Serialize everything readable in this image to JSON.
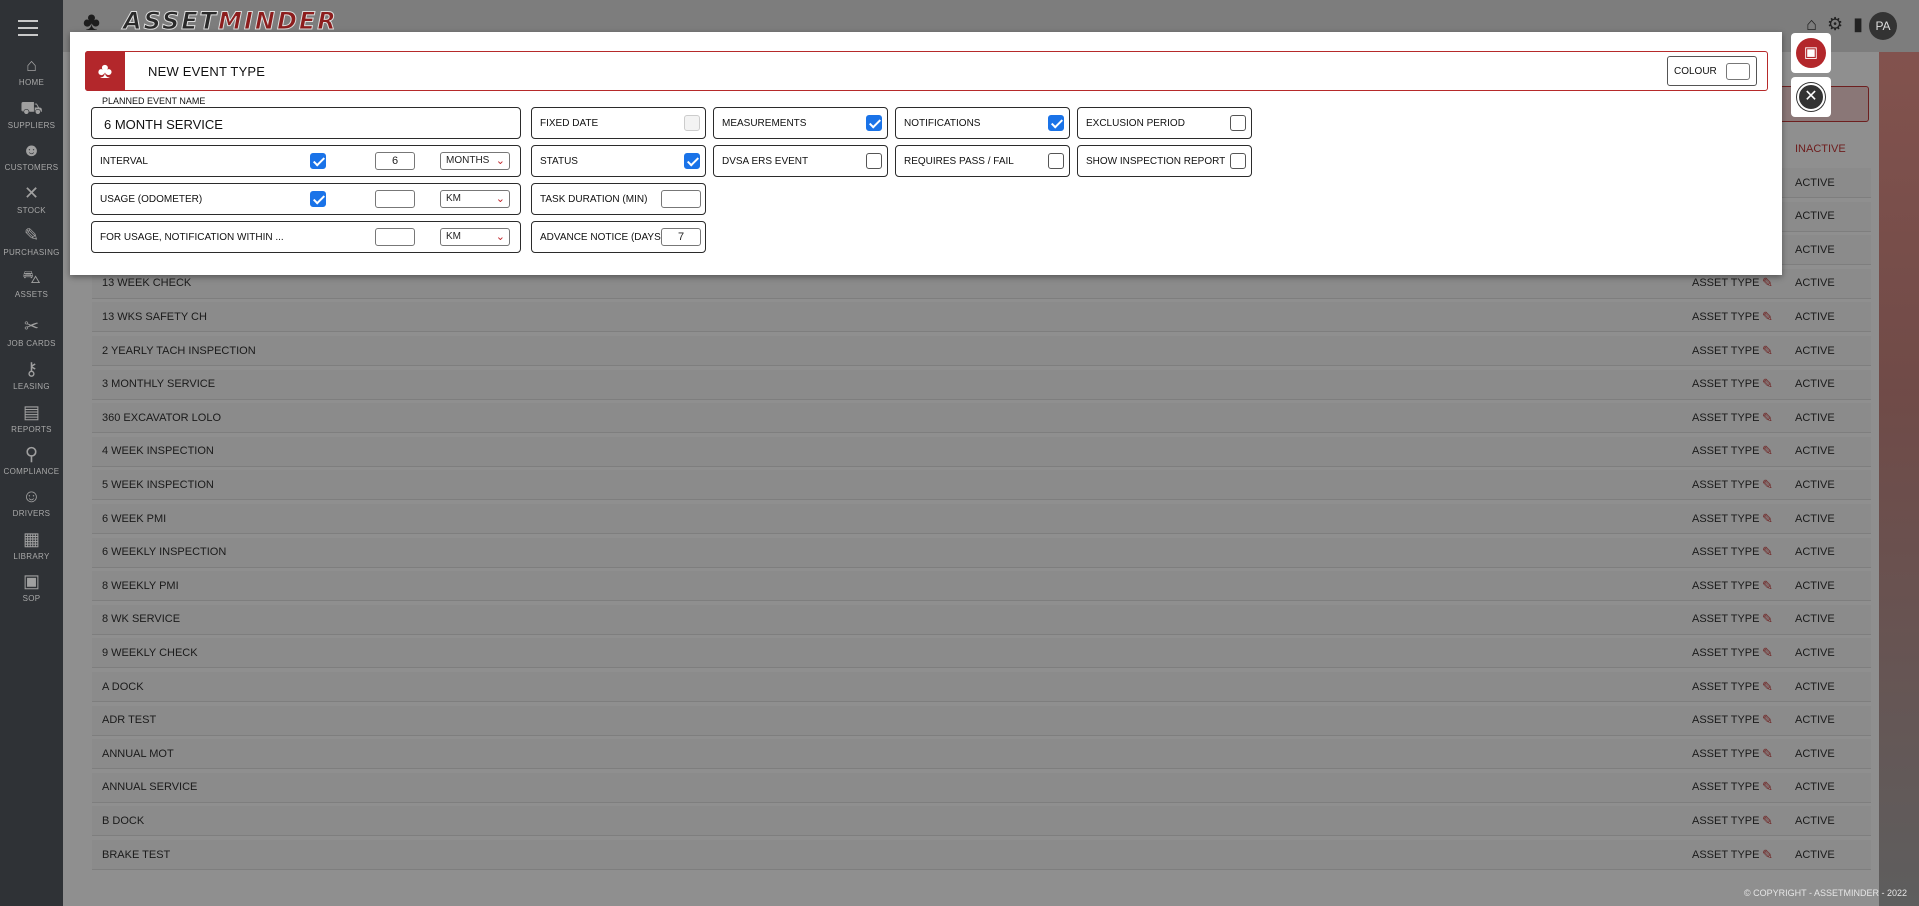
{
  "app": {
    "brand_a": "ASSET",
    "brand_b": "MINDER",
    "user_initials": "PA"
  },
  "sidebar": {
    "items": [
      {
        "label": "HOME",
        "icon": "⌂"
      },
      {
        "label": "SUPPLIERS",
        "icon": "⛟"
      },
      {
        "label": "CUSTOMERS",
        "icon": "☻"
      },
      {
        "label": "STOCK",
        "icon": "✕"
      },
      {
        "label": "PURCHASING",
        "icon": "✎"
      },
      {
        "label": "ASSETS",
        "icon": "⛍"
      },
      {
        "label": "JOB CARDS",
        "icon": "✂"
      },
      {
        "label": "LEASING",
        "icon": "⚷"
      },
      {
        "label": "REPORTS",
        "icon": "▤"
      },
      {
        "label": "COMPLIANCE",
        "icon": "⚲"
      },
      {
        "label": "DRIVERS",
        "icon": "☺"
      },
      {
        "label": "LIBRARY",
        "icon": "▦"
      },
      {
        "label": "SOP",
        "icon": "▣"
      }
    ]
  },
  "table": {
    "header_inactive": "INACTIVE",
    "rows": [
      {
        "name": "",
        "type": "",
        "status": "ACTIVE"
      },
      {
        "name": "",
        "type": "",
        "status": "ACTIVE"
      },
      {
        "name": "",
        "type": "",
        "status": "ACTIVE"
      },
      {
        "name": "13 WEEK CHECK",
        "type": "ASSET TYPE",
        "status": "ACTIVE"
      },
      {
        "name": "13 WKS SAFETY CH",
        "type": "ASSET TYPE",
        "status": "ACTIVE"
      },
      {
        "name": "2 YEARLY TACH INSPECTION",
        "type": "ASSET TYPE",
        "status": "ACTIVE"
      },
      {
        "name": "3 MONTHLY SERVICE",
        "type": "ASSET TYPE",
        "status": "ACTIVE"
      },
      {
        "name": "360 EXCAVATOR LOLO",
        "type": "ASSET TYPE",
        "status": "ACTIVE"
      },
      {
        "name": "4 WEEK INSPECTION",
        "type": "ASSET TYPE",
        "status": "ACTIVE"
      },
      {
        "name": "5 WEEK INSPECTION",
        "type": "ASSET TYPE",
        "status": "ACTIVE"
      },
      {
        "name": "6 WEEK PMI",
        "type": "ASSET TYPE",
        "status": "ACTIVE"
      },
      {
        "name": "6 WEEKLY INSPECTION",
        "type": "ASSET TYPE",
        "status": "ACTIVE"
      },
      {
        "name": "8 WEEKLY PMI",
        "type": "ASSET TYPE",
        "status": "ACTIVE"
      },
      {
        "name": "8 WK SERVICE",
        "type": "ASSET TYPE",
        "status": "ACTIVE"
      },
      {
        "name": "9 WEEKLY CHECK",
        "type": "ASSET TYPE",
        "status": "ACTIVE"
      },
      {
        "name": "A DOCK",
        "type": "ASSET TYPE",
        "status": "ACTIVE"
      },
      {
        "name": "ADR TEST",
        "type": "ASSET TYPE",
        "status": "ACTIVE"
      },
      {
        "name": "ANNUAL MOT",
        "type": "ASSET TYPE",
        "status": "ACTIVE"
      },
      {
        "name": "ANNUAL SERVICE",
        "type": "ASSET TYPE",
        "status": "ACTIVE"
      },
      {
        "name": "B DOCK",
        "type": "ASSET TYPE",
        "status": "ACTIVE"
      },
      {
        "name": "BRAKE TEST",
        "type": "ASSET TYPE",
        "status": "ACTIVE"
      }
    ]
  },
  "footer": {
    "copyright": "© COPYRIGHT - ASSETMINDER - 2022"
  },
  "modal": {
    "title": "NEW EVENT TYPE",
    "colour_label": "COLOUR",
    "planned_event_name_label": "PLANNED EVENT NAME",
    "planned_event_name_value": "6 MONTH SERVICE",
    "interval": {
      "label": "INTERVAL",
      "checked": true,
      "value": "6",
      "unit": "MONTHS"
    },
    "usage": {
      "label": "USAGE (ODOMETER)",
      "checked": true,
      "value": "",
      "unit": "KM"
    },
    "for_usage": {
      "label": "FOR USAGE, NOTIFICATION WITHIN ...",
      "value": "",
      "unit": "KM"
    },
    "fixed_date": {
      "label": "FIXED DATE",
      "checked": false,
      "disabled": true
    },
    "status": {
      "label": "STATUS",
      "checked": true
    },
    "task_duration": {
      "label": "TASK DURATION (MIN)",
      "value": ""
    },
    "advance_notice": {
      "label": "ADVANCE NOTICE (DAYS)",
      "value": "7"
    },
    "measurements": {
      "label": "MEASUREMENTS",
      "checked": true
    },
    "dvsa": {
      "label": "DVSA ERS EVENT",
      "checked": false
    },
    "notifications": {
      "label": "NOTIFICATIONS",
      "checked": true
    },
    "requires_pass_fail": {
      "label": "REQUIRES PASS / FAIL",
      "checked": false
    },
    "exclusion_period": {
      "label": "EXCLUSION PERIOD",
      "checked": false
    },
    "show_inspection_report": {
      "label": "SHOW INSPECTION REPORT",
      "checked": false
    }
  },
  "colors": {
    "brand_red": "#b3272b",
    "check_blue": "#1a73e8"
  }
}
